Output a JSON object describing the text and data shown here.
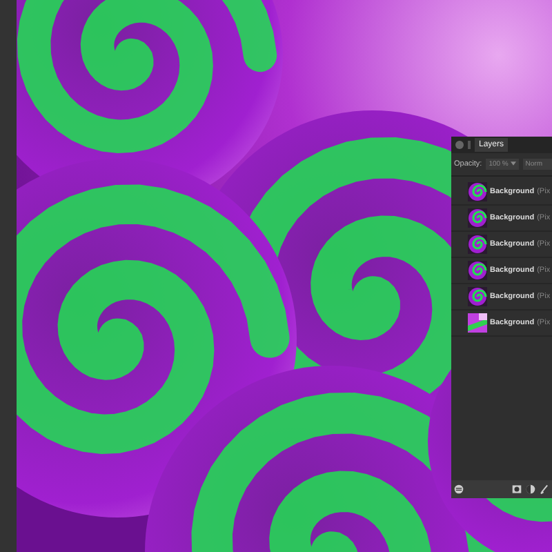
{
  "panel": {
    "tab": "Layers",
    "opacity_label": "Opacity:",
    "opacity_value": "100 %",
    "blend_mode": "Norm"
  },
  "layers": [
    {
      "name": "Background",
      "type": "(Pix",
      "kind": "swirl"
    },
    {
      "name": "Background",
      "type": "(Pix",
      "kind": "swirl"
    },
    {
      "name": "Background",
      "type": "(Pix",
      "kind": "swirl"
    },
    {
      "name": "Background",
      "type": "(Pix",
      "kind": "swirl"
    },
    {
      "name": "Background",
      "type": "(Pix",
      "kind": "swirl"
    },
    {
      "name": "Background",
      "type": "(Pix",
      "kind": "gradient"
    }
  ]
}
